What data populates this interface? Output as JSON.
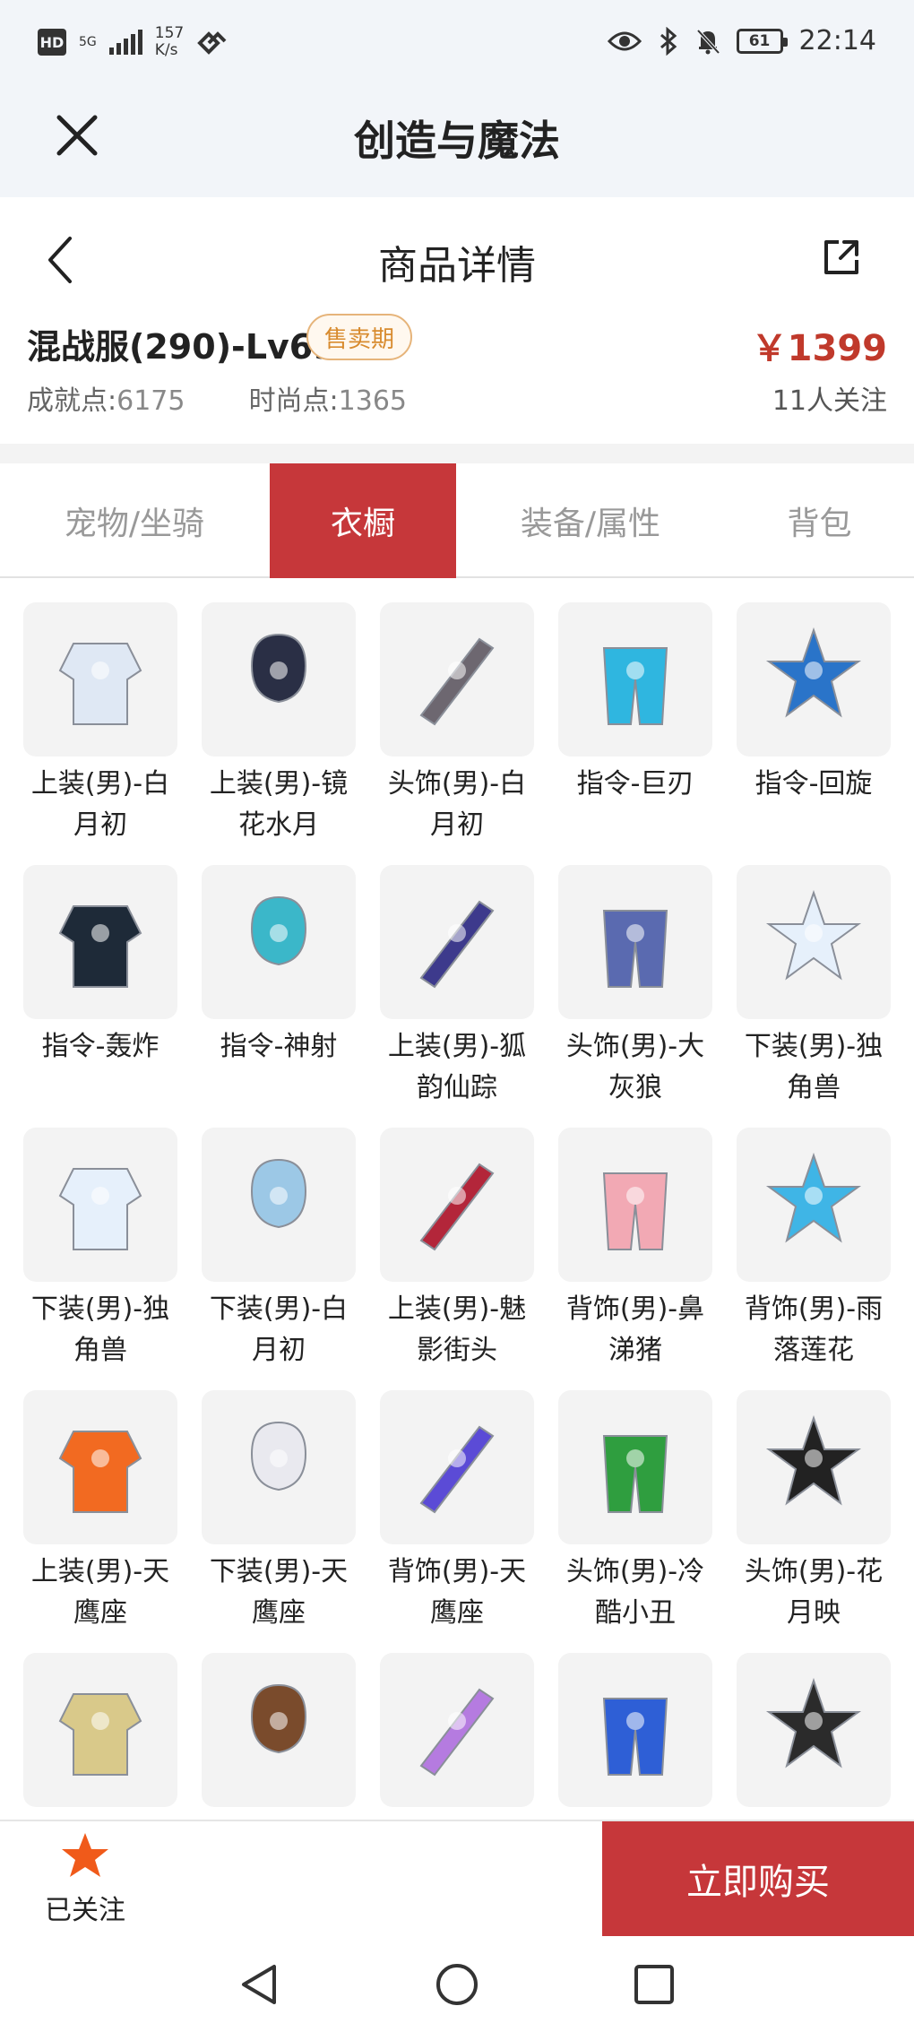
{
  "status_bar": {
    "hd": "HD",
    "network": "5G",
    "speed_value": "157",
    "speed_unit": "K/s",
    "battery": "61",
    "time": "22:14"
  },
  "app": {
    "title": "创造与魔法"
  },
  "page": {
    "title": "商品详情"
  },
  "product": {
    "name": "混战服(290)-Lv69",
    "badge": "售卖期",
    "price": "￥1399",
    "achievement_label": "成就点:",
    "achievement_value": "6175",
    "fashion_label": "时尚点:",
    "fashion_value": "1365",
    "followers": "11人关注"
  },
  "tabs": [
    {
      "label": "宠物/坐骑",
      "active": false
    },
    {
      "label": "衣橱",
      "active": true
    },
    {
      "label": "装备/属性",
      "active": false
    },
    {
      "label": "背包",
      "active": false
    }
  ],
  "items": [
    {
      "label": "上装(男)-白月初",
      "icon": "white-top-icon",
      "color": "#dfe8f4"
    },
    {
      "label": "上装(男)-镜花水月",
      "icon": "dark-coat-icon",
      "color": "#2a2f45"
    },
    {
      "label": "头饰(男)-白月初",
      "icon": "hair-head-icon",
      "color": "#6d6770"
    },
    {
      "label": "指令-巨刃",
      "icon": "blade-icon",
      "color": "#2fb6e0"
    },
    {
      "label": "指令-回旋",
      "icon": "scythe-icon",
      "color": "#2a74c9"
    },
    {
      "label": "指令-轰炸",
      "icon": "gauntlet-icon",
      "color": "#1e2a38"
    },
    {
      "label": "指令-神射",
      "icon": "bow-icon",
      "color": "#3bb7c9"
    },
    {
      "label": "上装(男)-狐韵仙踪",
      "icon": "robe-icon",
      "color": "#3d3a8c"
    },
    {
      "label": "头饰(男)-大灰狼",
      "icon": "wolf-head-icon",
      "color": "#5a6ab0"
    },
    {
      "label": "下装(男)-独角兽",
      "icon": "boots-icon",
      "color": "#e6f0fb"
    },
    {
      "label": "下装(男)-独角兽",
      "icon": "boots-icon",
      "color": "#e6f0fb"
    },
    {
      "label": "下装(男)-白月初",
      "icon": "pants-icon",
      "color": "#9cc8e6"
    },
    {
      "label": "上装(男)-魅影街头",
      "icon": "winged-jacket-icon",
      "color": "#b3263a"
    },
    {
      "label": "背饰(男)-鼻涕猪",
      "icon": "pig-icon",
      "color": "#f2a9b4"
    },
    {
      "label": "背饰(男)-雨落莲花",
      "icon": "lotus-staff-icon",
      "color": "#3fb5e6"
    },
    {
      "label": "上装(男)-天鹰座",
      "icon": "orange-armor-icon",
      "color": "#f26a21"
    },
    {
      "label": "下装(男)-天鹰座",
      "icon": "white-boots-icon",
      "color": "#e9e9ef"
    },
    {
      "label": "背饰(男)-天鹰座",
      "icon": "orb-icon",
      "color": "#5b4bd6"
    },
    {
      "label": "头饰(男)-冷酷小丑",
      "icon": "clown-icon",
      "color": "#2f9e3f"
    },
    {
      "label": "头饰(男)-花月映",
      "icon": "long-hair-icon",
      "color": "#222222"
    },
    {
      "label": "",
      "icon": "scarf-outfit-icon",
      "color": "#d9c98a"
    },
    {
      "label": "",
      "icon": "bear-ears-icon",
      "color": "#7a4b2c"
    },
    {
      "label": "",
      "icon": "flower-lei-icon",
      "color": "#b57be0"
    },
    {
      "label": "",
      "icon": "octopus-head-icon",
      "color": "#2e5fd6"
    },
    {
      "label": "",
      "icon": "red-streak-hair-icon",
      "color": "#2b2b2b"
    }
  ],
  "bottom": {
    "follow_label": "已关注",
    "buy_label": "立即购买"
  },
  "colors": {
    "accent": "#c6373a",
    "price": "#c0392b",
    "badge": "#d88b2f",
    "star": "#f05a1a"
  }
}
